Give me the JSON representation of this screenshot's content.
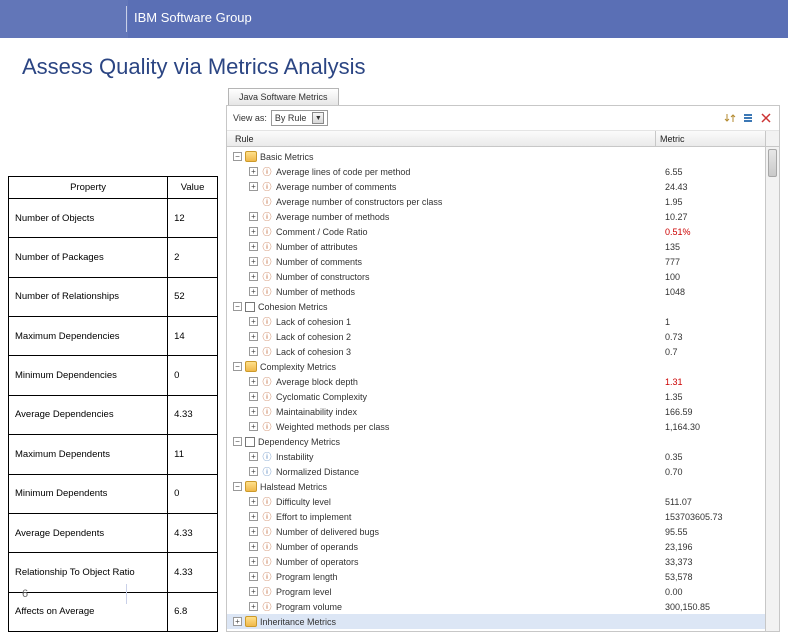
{
  "header": {
    "group_title": "IBM Software Group"
  },
  "page_title": "Assess Quality via Metrics Analysis",
  "page_number": "6",
  "property_table": {
    "headers": {
      "property": "Property",
      "value": "Value"
    },
    "rows": [
      {
        "property": "Number of Objects",
        "value": "12"
      },
      {
        "property": "Number of Packages",
        "value": "2"
      },
      {
        "property": "Number of Relationships",
        "value": "52"
      },
      {
        "property": "Maximum Dependencies",
        "value": "14"
      },
      {
        "property": "Minimum Dependencies",
        "value": "0"
      },
      {
        "property": "Average Dependencies",
        "value": "4.33"
      },
      {
        "property": "Maximum Dependents",
        "value": "11"
      },
      {
        "property": "Minimum Dependents",
        "value": "0"
      },
      {
        "property": "Average Dependents",
        "value": "4.33"
      },
      {
        "property": "Relationship To Object Ratio",
        "value": "4.33"
      },
      {
        "property": "Affects on Average",
        "value": "6.8"
      }
    ]
  },
  "metrics_view": {
    "tab_title": "Java Software Metrics",
    "toolbar": {
      "viewas_label": "View as:",
      "viewas_value": "By Rule"
    },
    "columns": {
      "rule": "Rule",
      "metric": "Metric"
    },
    "tree": [
      {
        "level": 0,
        "expander": "minus",
        "icon": "dash",
        "label": "Basic Metrics",
        "metric": "",
        "red": false
      },
      {
        "level": 1,
        "expander": "plus",
        "icon": "leaf",
        "label": "Average lines of code per method",
        "metric": "6.55",
        "red": false
      },
      {
        "level": 1,
        "expander": "plus",
        "icon": "leaf",
        "label": "Average number of comments",
        "metric": "24.43",
        "red": false
      },
      {
        "level": 1,
        "expander": "none",
        "icon": "leaf",
        "label": "Average number of constructors per class",
        "metric": "1.95",
        "red": false
      },
      {
        "level": 1,
        "expander": "plus",
        "icon": "leaf",
        "label": "Average number of methods",
        "metric": "10.27",
        "red": false
      },
      {
        "level": 1,
        "expander": "plus",
        "icon": "leaf",
        "label": "Comment / Code Ratio",
        "metric": "0.51%",
        "red": true
      },
      {
        "level": 1,
        "expander": "plus",
        "icon": "leaf",
        "label": "Number of attributes",
        "metric": "135",
        "red": false
      },
      {
        "level": 1,
        "expander": "plus",
        "icon": "leaf",
        "label": "Number of comments",
        "metric": "777",
        "red": false
      },
      {
        "level": 1,
        "expander": "plus",
        "icon": "leaf",
        "label": "Number of constructors",
        "metric": "100",
        "red": false
      },
      {
        "level": 1,
        "expander": "plus",
        "icon": "leaf",
        "label": "Number of methods",
        "metric": "1048",
        "red": false
      },
      {
        "level": 0,
        "expander": "minus",
        "icon": "checkbox",
        "label": "Cohesion Metrics",
        "metric": "",
        "red": false
      },
      {
        "level": 1,
        "expander": "plus",
        "icon": "leaf",
        "label": "Lack of cohesion 1",
        "metric": "1",
        "red": false
      },
      {
        "level": 1,
        "expander": "plus",
        "icon": "leaf",
        "label": "Lack of cohesion 2",
        "metric": "0.73",
        "red": false
      },
      {
        "level": 1,
        "expander": "plus",
        "icon": "leaf",
        "label": "Lack of cohesion 3",
        "metric": "0.7",
        "red": false
      },
      {
        "level": 0,
        "expander": "minus",
        "icon": "dash",
        "label": "Complexity Metrics",
        "metric": "",
        "red": false
      },
      {
        "level": 1,
        "expander": "plus",
        "icon": "leaf",
        "label": "Average block depth",
        "metric": "1.31",
        "red": true
      },
      {
        "level": 1,
        "expander": "plus",
        "icon": "leaf",
        "label": "Cyclomatic Complexity",
        "metric": "1.35",
        "red": false
      },
      {
        "level": 1,
        "expander": "plus",
        "icon": "leaf",
        "label": "Maintainability index",
        "metric": "166.59",
        "red": false
      },
      {
        "level": 1,
        "expander": "plus",
        "icon": "leaf",
        "label": "Weighted methods per class",
        "metric": "1,164.30",
        "red": false
      },
      {
        "level": 0,
        "expander": "minus",
        "icon": "checkbox",
        "label": "Dependency Metrics",
        "metric": "",
        "red": false
      },
      {
        "level": 1,
        "expander": "plus",
        "icon": "leaf2",
        "label": "Instability",
        "metric": "0.35",
        "red": false
      },
      {
        "level": 1,
        "expander": "plus",
        "icon": "leaf2",
        "label": "Normalized Distance",
        "metric": "0.70",
        "red": false
      },
      {
        "level": 0,
        "expander": "minus",
        "icon": "dash",
        "label": "Halstead Metrics",
        "metric": "",
        "red": false
      },
      {
        "level": 1,
        "expander": "plus",
        "icon": "leaf",
        "label": "Difficulty level",
        "metric": "511.07",
        "red": false
      },
      {
        "level": 1,
        "expander": "plus",
        "icon": "leaf",
        "label": "Effort to implement",
        "metric": "153703605.73",
        "red": false
      },
      {
        "level": 1,
        "expander": "plus",
        "icon": "leaf",
        "label": "Number of delivered bugs",
        "metric": "95.55",
        "red": false
      },
      {
        "level": 1,
        "expander": "plus",
        "icon": "leaf",
        "label": "Number of operands",
        "metric": "23,196",
        "red": false
      },
      {
        "level": 1,
        "expander": "plus",
        "icon": "leaf",
        "label": "Number of operators",
        "metric": "33,373",
        "red": false
      },
      {
        "level": 1,
        "expander": "plus",
        "icon": "leaf",
        "label": "Program length",
        "metric": "53,578",
        "red": false
      },
      {
        "level": 1,
        "expander": "plus",
        "icon": "leaf",
        "label": "Program level",
        "metric": "0.00",
        "red": false
      },
      {
        "level": 1,
        "expander": "plus",
        "icon": "leaf",
        "label": "Program volume",
        "metric": "300,150.85",
        "red": false
      },
      {
        "level": 0,
        "expander": "plus",
        "icon": "dash",
        "label": "Inheritance Metrics",
        "metric": "",
        "red": false,
        "selected": true
      }
    ]
  }
}
